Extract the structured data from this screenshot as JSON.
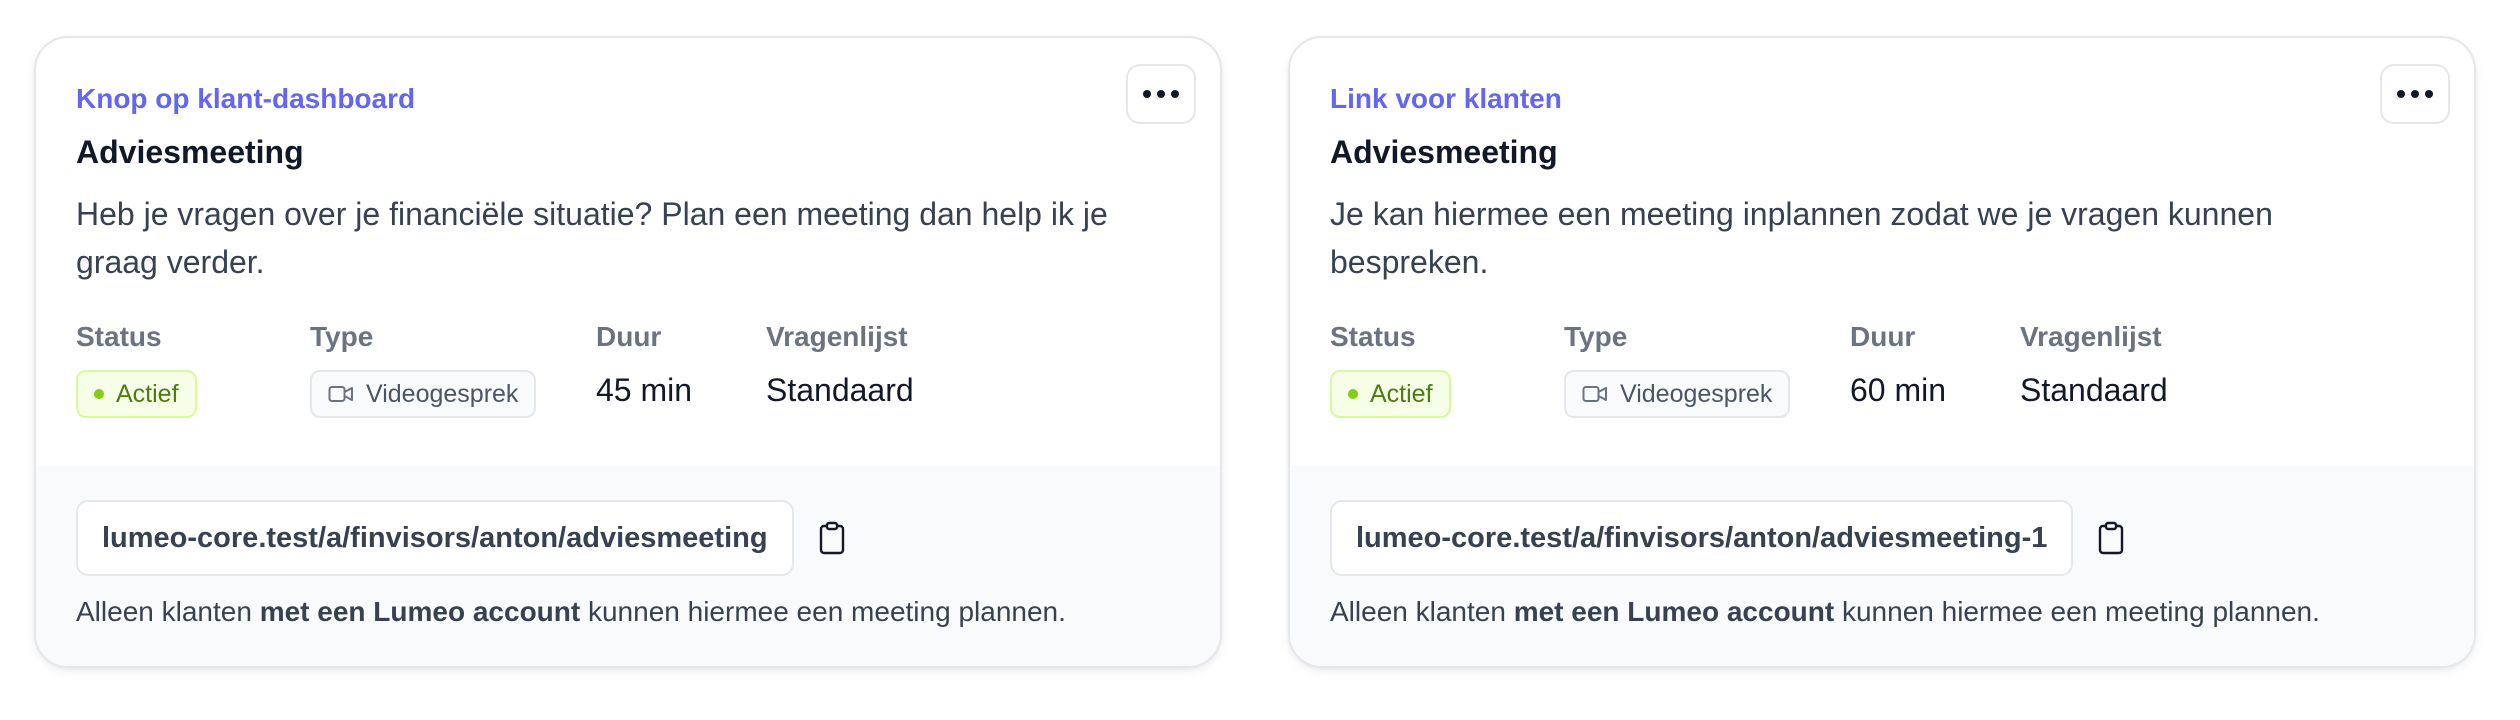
{
  "cards": [
    {
      "eyebrow": "Knop op klant-dashboard",
      "title": "Adviesmeeting",
      "description": "Heb je vragen over je financiële situatie? Plan een meeting dan help ik je graag verder.",
      "meta": {
        "status_label": "Status",
        "status_value": "Actief",
        "type_label": "Type",
        "type_value": "Videogesprek",
        "duration_label": "Duur",
        "duration_value": "45 min",
        "questionnaire_label": "Vragenlijst",
        "questionnaire_value": "Standaard"
      },
      "url": "lumeo-core.test/a/finvisors/anton/adviesmeeting",
      "note": {
        "prefix": "Alleen klanten ",
        "bold": "met een Lumeo account",
        "suffix": " kunnen hiermee een meeting plannen."
      }
    },
    {
      "eyebrow": "Link voor klanten",
      "title": "Adviesmeeting",
      "description": "Je kan hiermee een meeting inplannen zodat we je vragen kunnen bespreken.",
      "meta": {
        "status_label": "Status",
        "status_value": "Actief",
        "type_label": "Type",
        "type_value": "Videogesprek",
        "duration_label": "Duur",
        "duration_value": "60 min",
        "questionnaire_label": "Vragenlijst",
        "questionnaire_value": "Standaard"
      },
      "url": "lumeo-core.test/a/finvisors/anton/adviesmeeting-1",
      "note": {
        "prefix": "Alleen klanten ",
        "bold": "met een Lumeo account",
        "suffix": " kunnen hiermee een meeting plannen."
      }
    }
  ],
  "icons": {
    "menu": "more-horizontal-icon",
    "status": "status-dot-icon",
    "type": "video-camera-icon",
    "copy": "clipboard-icon"
  },
  "colors": {
    "accent": "#6366f1",
    "status_text": "#4d7c0f",
    "status_bg": "#f7fee7",
    "status_dot": "#84cc16",
    "footer_bg": "#f8fafc"
  }
}
